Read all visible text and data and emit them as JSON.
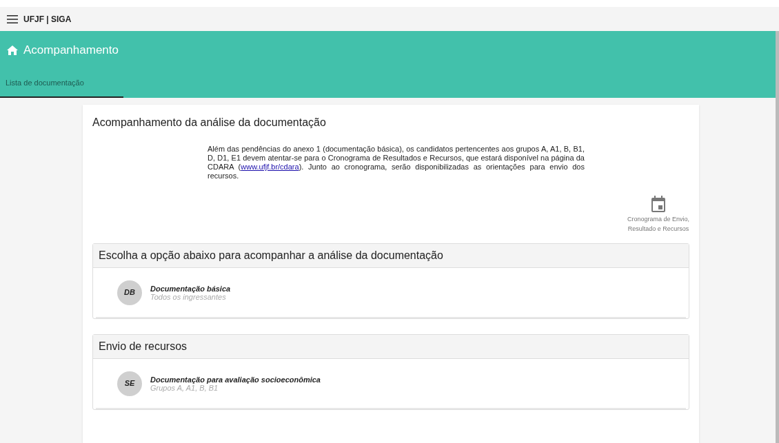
{
  "topbar": {
    "title": "UFJF | SIGA"
  },
  "header": {
    "title": "Acompanhamento"
  },
  "tabs": [
    {
      "label": "Lista de documentação",
      "selected": true
    }
  ],
  "card": {
    "title": "Acompanhamento da análise da documentação",
    "notice": {
      "before": "Além das pendências do anexo 1 (documentação básica), os candidatos pertencentes aos grupos A, A1, B, B1, D, D1, E1 devem atentar-se para o Cronograma de Resultados e Recursos, que estará disponível na página da CDARA (",
      "link": "www.ufjf.br/cdara",
      "after": "). Junto ao cronograma, serão disponibilizadas as orientações para envio dos recursos."
    },
    "schedule_link": {
      "line1": "Cronograma de Envio,",
      "line2": "Resultado e Recursos"
    },
    "sections": [
      {
        "title": "Escolha a opção abaixo para acompanhar a análise da documentação",
        "items": [
          {
            "avatar": "DB",
            "title": "Documentação básica",
            "subtitle": "Todos os ingressantes"
          }
        ]
      },
      {
        "title": "Envio de recursos",
        "items": [
          {
            "avatar": "SE",
            "title": "Documentação para avaliação socioeconômica",
            "subtitle": "Grupos A, A1, B, B1"
          }
        ]
      }
    ]
  }
}
